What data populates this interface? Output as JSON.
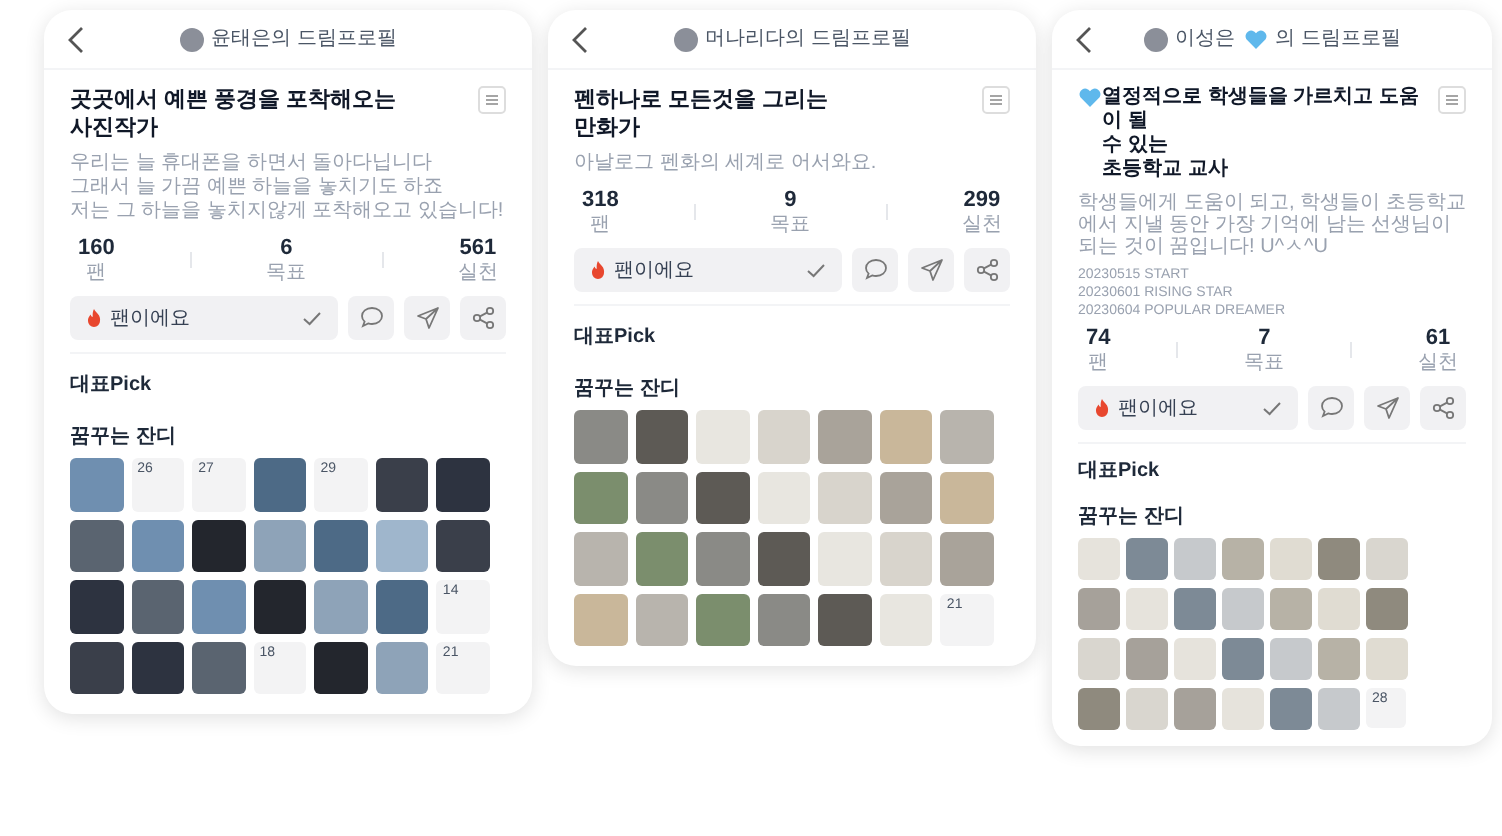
{
  "profiles": [
    {
      "header": {
        "name_before": "윤태은의 드림프로필"
      },
      "title": "곳곳에서 예쁜 풍경을 포착해오는\n사진작가",
      "bio": [
        "우리는 늘 휴대폰을 하면서 돌아다닙니다",
        "그래서 늘 가끔 예쁜 하늘을 놓치기도 하죠",
        "저는 그 하늘을 놓치지않게 포착해오고 있습니다!"
      ],
      "stats": [
        {
          "value": "160",
          "label": "팬"
        },
        {
          "value": "6",
          "label": "목표"
        },
        {
          "value": "561",
          "label": "실천"
        }
      ],
      "fan_button": "팬이에요",
      "pick_title": "대표Pick",
      "lawn_title": "꿈꾸는 잔디",
      "lawn": [
        {
          "kind": "photo"
        },
        {
          "kind": "date",
          "day": "26"
        },
        {
          "kind": "date",
          "day": "27"
        },
        {
          "kind": "photo"
        },
        {
          "kind": "date",
          "day": "29"
        },
        {
          "kind": "photo"
        },
        {
          "kind": "photo"
        },
        {
          "kind": "photo"
        },
        {
          "kind": "photo"
        },
        {
          "kind": "photo"
        },
        {
          "kind": "photo"
        },
        {
          "kind": "photo"
        },
        {
          "kind": "photo"
        },
        {
          "kind": "photo"
        },
        {
          "kind": "photo"
        },
        {
          "kind": "photo"
        },
        {
          "kind": "photo"
        },
        {
          "kind": "photo"
        },
        {
          "kind": "photo"
        },
        {
          "kind": "photo"
        },
        {
          "kind": "date",
          "day": "14"
        },
        {
          "kind": "photo"
        },
        {
          "kind": "photo"
        },
        {
          "kind": "photo"
        },
        {
          "kind": "date",
          "day": "18"
        },
        {
          "kind": "photo"
        },
        {
          "kind": "photo"
        },
        {
          "kind": "date",
          "day": "21"
        }
      ]
    },
    {
      "header": {
        "name_before": "머나리다의 드림프로필"
      },
      "title": "펜하나로 모든것을 그리는\n만화가",
      "bio": [
        "아날로그 펜화의 세계로 어서와요."
      ],
      "stats": [
        {
          "value": "318",
          "label": "팬"
        },
        {
          "value": "9",
          "label": "목표"
        },
        {
          "value": "299",
          "label": "실천"
        }
      ],
      "fan_button": "팬이에요",
      "pick_title": "대표Pick",
      "lawn_title": "꿈꾸는 잔디",
      "lawn": [
        {
          "kind": "photo"
        },
        {
          "kind": "photo"
        },
        {
          "kind": "photo"
        },
        {
          "kind": "photo"
        },
        {
          "kind": "photo"
        },
        {
          "kind": "photo"
        },
        {
          "kind": "photo"
        },
        {
          "kind": "photo"
        },
        {
          "kind": "photo"
        },
        {
          "kind": "photo"
        },
        {
          "kind": "photo"
        },
        {
          "kind": "photo"
        },
        {
          "kind": "photo"
        },
        {
          "kind": "photo"
        },
        {
          "kind": "photo"
        },
        {
          "kind": "photo"
        },
        {
          "kind": "photo"
        },
        {
          "kind": "photo"
        },
        {
          "kind": "photo"
        },
        {
          "kind": "photo"
        },
        {
          "kind": "photo"
        },
        {
          "kind": "photo"
        },
        {
          "kind": "photo"
        },
        {
          "kind": "photo"
        },
        {
          "kind": "photo"
        },
        {
          "kind": "photo"
        },
        {
          "kind": "photo"
        },
        {
          "kind": "date",
          "day": "21"
        }
      ]
    },
    {
      "header": {
        "name_before": "이성은",
        "name_after": "의 드림프로필"
      },
      "title_heart": true,
      "title": "열정적으로 학생들을 가르치고 도움이 될\n수 있는\n초등학교 교사",
      "bio": [
        "학생들에게 도움이 되고, 학생들이 초등학교에서 지낼 동안 가장 기억에 남는 선생님이 되는 것이 꿈입니다! U^ㅅ^U"
      ],
      "milestones": [
        "20230515 START",
        "20230601 RISING STAR",
        "20230604 POPULAR DREAMER"
      ],
      "stats": [
        {
          "value": "74",
          "label": "팬"
        },
        {
          "value": "7",
          "label": "목표"
        },
        {
          "value": "61",
          "label": "실천"
        }
      ],
      "fan_button": "팬이에요",
      "pick_title": "대표Pick",
      "lawn_title": "꿈꾸는 잔디",
      "lawn": [
        {
          "kind": "photo"
        },
        {
          "kind": "photo"
        },
        {
          "kind": "photo"
        },
        {
          "kind": "photo"
        },
        {
          "kind": "photo"
        },
        {
          "kind": "photo"
        },
        {
          "kind": "photo"
        },
        {
          "kind": "photo"
        },
        {
          "kind": "photo"
        },
        {
          "kind": "photo"
        },
        {
          "kind": "photo"
        },
        {
          "kind": "photo"
        },
        {
          "kind": "photo"
        },
        {
          "kind": "photo"
        },
        {
          "kind": "photo"
        },
        {
          "kind": "photo"
        },
        {
          "kind": "photo"
        },
        {
          "kind": "photo"
        },
        {
          "kind": "photo"
        },
        {
          "kind": "photo"
        },
        {
          "kind": "photo"
        },
        {
          "kind": "photo"
        },
        {
          "kind": "photo"
        },
        {
          "kind": "photo"
        },
        {
          "kind": "photo"
        },
        {
          "kind": "photo"
        },
        {
          "kind": "photo"
        },
        {
          "kind": "date",
          "day": "28"
        }
      ]
    }
  ]
}
